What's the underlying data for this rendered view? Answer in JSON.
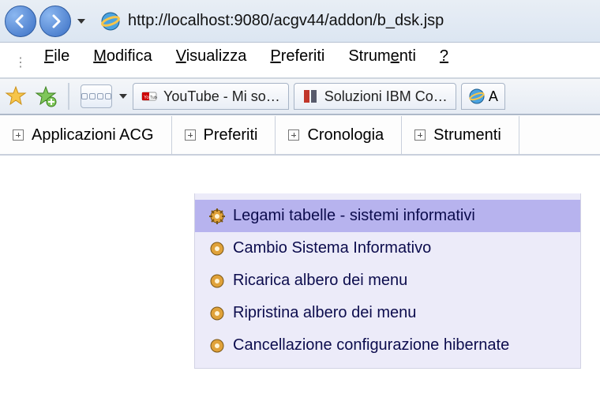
{
  "url": "http://localhost:9080/acgv44/addon/b_dsk.jsp",
  "menu": {
    "file": "File",
    "modifica": "Modifica",
    "visualizza": "Visualizza",
    "preferiti": "Preferiti",
    "strumenti": "Strumenti",
    "help": "?"
  },
  "tabs": {
    "youtube": "YouTube - Mi so…",
    "ibm": "Soluzioni IBM Co…",
    "current_prefix": "A"
  },
  "app_tabs": {
    "applicazioni": "Applicazioni ACG",
    "preferiti": "Preferiti",
    "cronologia": "Cronologia",
    "strumenti": "Strumenti"
  },
  "dropdown": {
    "legami": "Legami tabelle - sistemi informativi",
    "cambio": "Cambio Sistema Informativo",
    "ricarica": "Ricarica albero dei menu",
    "ripristina": "Ripristina albero dei menu",
    "cancellazione": "Cancellazione configurazione hibernate"
  }
}
